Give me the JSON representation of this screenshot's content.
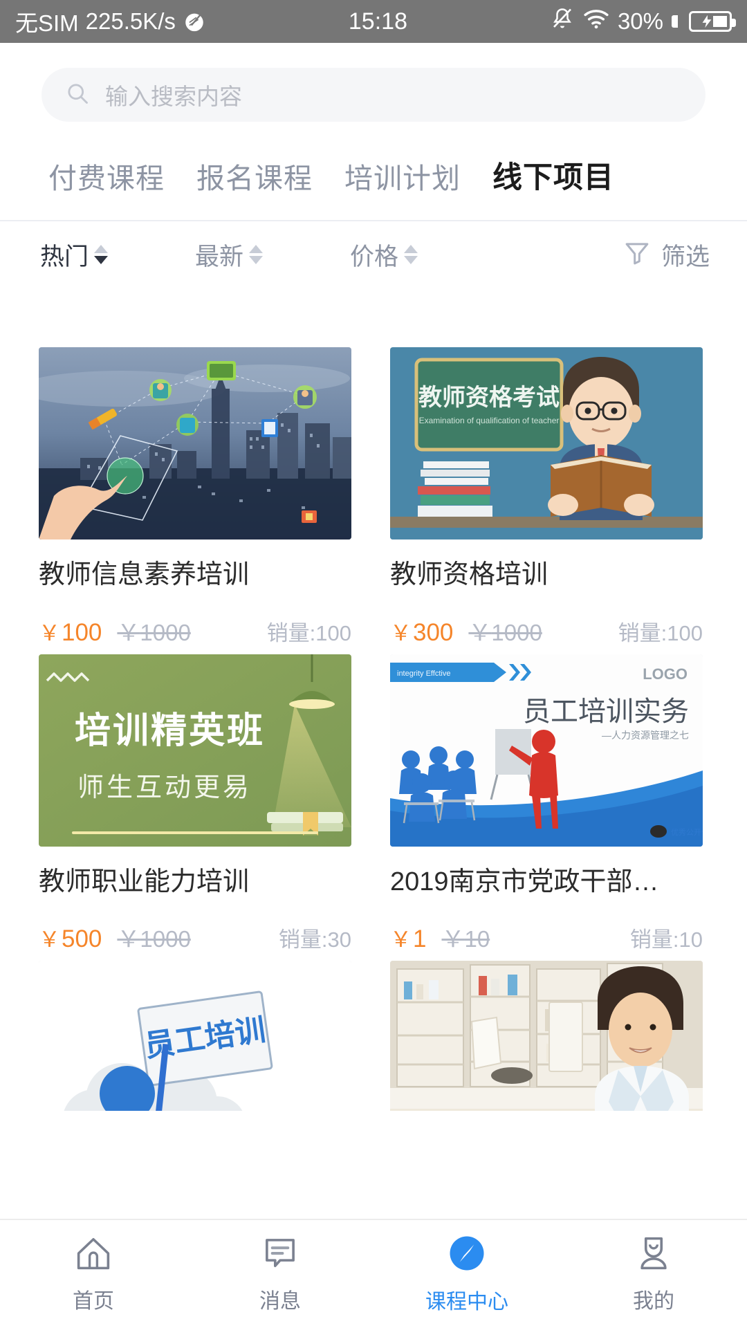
{
  "statusbar": {
    "carrier": "无SIM",
    "netspeed": "225.5K/s",
    "time": "15:18",
    "battery_pct": "30%",
    "icons": [
      "speed-icon",
      "mute-bell-icon",
      "wifi-icon",
      "battery-charging-icon"
    ]
  },
  "search": {
    "placeholder": "输入搜索内容",
    "value": "",
    "icon": "search-icon"
  },
  "tabs": [
    {
      "label": "付费课程",
      "active": false
    },
    {
      "label": "报名课程",
      "active": false
    },
    {
      "label": "培训计划",
      "active": false
    },
    {
      "label": "线下项目",
      "active": true
    }
  ],
  "sortbar": {
    "items": [
      {
        "label": "热门",
        "active": true,
        "direction": "desc"
      },
      {
        "label": "最新",
        "active": false,
        "direction": "none"
      },
      {
        "label": "价格",
        "active": false,
        "direction": "none"
      }
    ],
    "filter_label": "筛选",
    "filter_icon": "funnel-icon"
  },
  "products": [
    {
      "title": "教师信息素养培训",
      "price": "100",
      "original_price": "1000",
      "sales": "销量:100",
      "currency": "￥",
      "image": "smart-city-network-touch"
    },
    {
      "title": "教师资格培训",
      "price": "300",
      "original_price": "1000",
      "sales": "销量:100",
      "currency": "￥",
      "image": "student-reading-chalkboard",
      "image_text_cn": "教师资格考试",
      "image_text_en": "Examination of qualification of teacher"
    },
    {
      "title": "教师职业能力培训",
      "price": "500",
      "original_price": "1000",
      "sales": "销量:30",
      "currency": "￥",
      "image": "green-training-banner",
      "image_text_cn": "培训精英班",
      "image_text_sub": "师生互动更易"
    },
    {
      "title": "2019南京市党政干部…",
      "price": "1",
      "original_price": "10",
      "sales": "销量:10",
      "currency": "￥",
      "image": "staff-training-slide",
      "image_text_cn": "员工培训实务",
      "image_text_sub": "—人力资源管理之七",
      "image_logo": "LOGO"
    },
    {
      "title": "",
      "price": "",
      "original_price": "",
      "sales": "",
      "currency": "",
      "image": "blue-figure-sign",
      "image_text_cn": "员工培训"
    },
    {
      "title": "",
      "price": "",
      "original_price": "",
      "sales": "",
      "currency": "",
      "image": "pharmacist-woman"
    }
  ],
  "tabbar": [
    {
      "label": "首页",
      "icon": "home-icon",
      "active": false
    },
    {
      "label": "消息",
      "icon": "message-icon",
      "active": false
    },
    {
      "label": "课程中心",
      "icon": "compass-icon",
      "active": true
    },
    {
      "label": "我的",
      "icon": "person-icon",
      "active": false
    }
  ],
  "colors": {
    "accent_blue": "#2b8cf0",
    "price_orange": "#f5852a",
    "muted": "#b5bac6",
    "statusbar_bg": "#767676"
  }
}
